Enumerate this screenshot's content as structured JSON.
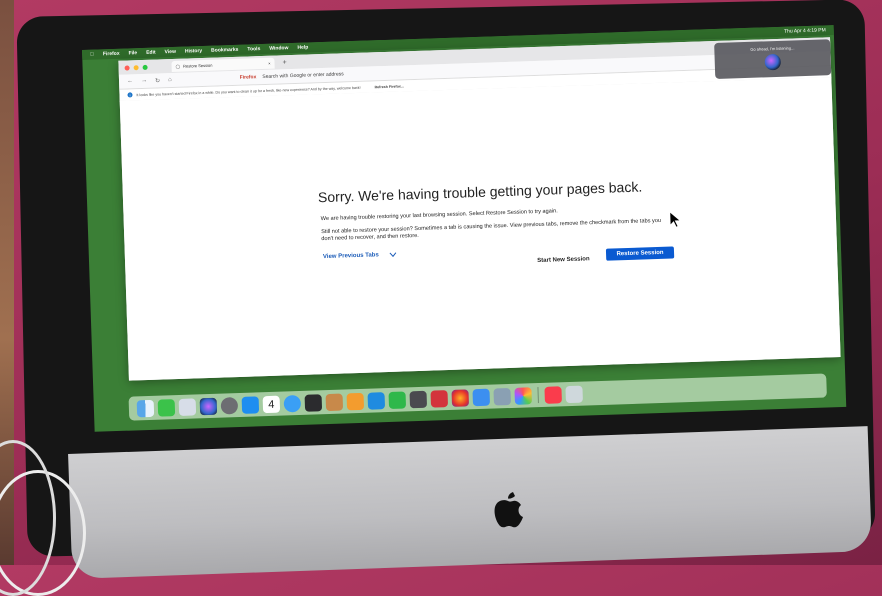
{
  "menubar": {
    "app_name": "Firefox",
    "items": [
      "File",
      "Edit",
      "View",
      "History",
      "Bookmarks",
      "Tools",
      "Window",
      "Help"
    ],
    "clock": "Thu Apr 4  4:19 PM"
  },
  "browser": {
    "tab_title": "Restore Session",
    "tab_close": "×",
    "new_tab": "+",
    "url_brand": "Firefox",
    "url_placeholder": "Search with Google or enter address",
    "infobar_text": "It looks like you haven't started Firefox in a while. Do you want to clean it up for a fresh, like-new experience? And by the way, welcome back!",
    "infobar_action": "Refresh Firefox..."
  },
  "error_page": {
    "title": "Sorry. We're having trouble getting your pages back.",
    "paragraph1": "We are having trouble restoring your last browsing session. Select Restore Session to try again.",
    "paragraph2": "Still not able to restore your session? Sometimes a tab is causing the issue. View previous tabs, remove the checkmark from the tabs you don't need to recover, and then restore.",
    "view_previous_label": "View Previous Tabs",
    "start_new_label": "Start New Session",
    "restore_label": "Restore Session"
  },
  "siri": {
    "text": "Go ahead, I'm listening..."
  },
  "colors": {
    "desktop_green": "#3b7f36",
    "accent_blue": "#0a5ad1",
    "link_blue": "#1a5bb8",
    "backdrop_magenta": "#a8325c"
  },
  "dock_icons": [
    "finder-icon",
    "facetime-icon",
    "launchpad-icon",
    "siri-icon",
    "system-preferences-icon",
    "app-store-icon",
    "calendar-icon",
    "safari-icon",
    "calculator-icon",
    "contacts-icon",
    "pages-icon",
    "keynote-icon",
    "numbers-icon",
    "screenshot-icon",
    "photo-booth-icon",
    "firefox-icon",
    "mail-icon",
    "preview-icon",
    "photos-icon",
    "music-icon",
    "trash-icon"
  ],
  "calendar_day": "4"
}
